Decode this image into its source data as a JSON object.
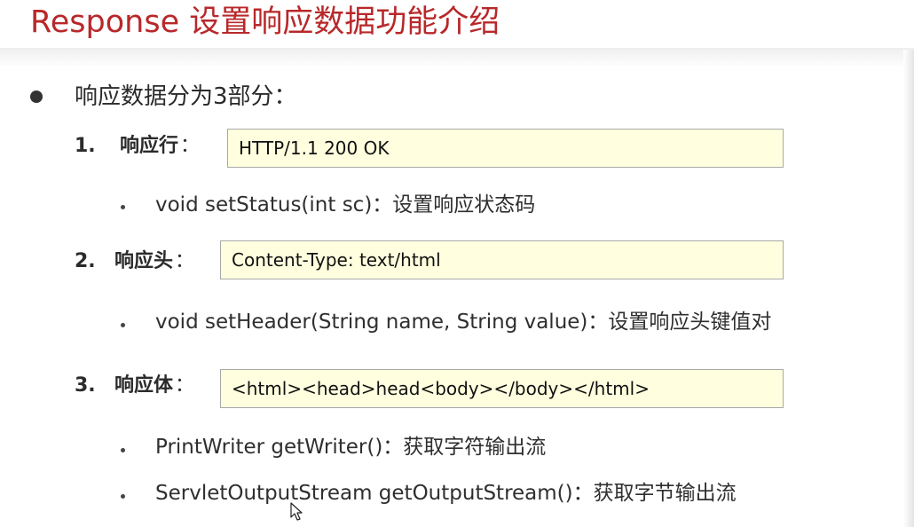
{
  "slide": {
    "title": "Response 设置响应数据功能介绍",
    "intro": "响应数据分为3部分："
  },
  "sections": [
    {
      "number": "1.",
      "label": "响应行",
      "colon": "：",
      "example": "HTTP/1.1 200 OK",
      "methods": [
        "void setStatus(int sc)：设置响应状态码"
      ]
    },
    {
      "number": "2.",
      "label": "响应头",
      "colon": "：",
      "example": "Content-Type: text/html",
      "methods": [
        "void setHeader(String name, String value)：设置响应头键值对"
      ]
    },
    {
      "number": "3.",
      "label": "响应体",
      "colon": "：",
      "example": "<html><head>head<body></body></html>",
      "methods": [
        "PrintWriter getWriter()：获取字符输出流",
        "ServletOutputStream getOutputStream()：获取字节输出流"
      ]
    }
  ],
  "colors": {
    "title": "#b8282a",
    "code_box_bg": "#ffffdf",
    "code_box_border": "#a9a9a9",
    "text": "#2b2b2b"
  },
  "icons": {
    "main_bullet": "filled-circle",
    "sub_bullet": "small-dot",
    "pointer": "mouse-cursor-icon"
  }
}
